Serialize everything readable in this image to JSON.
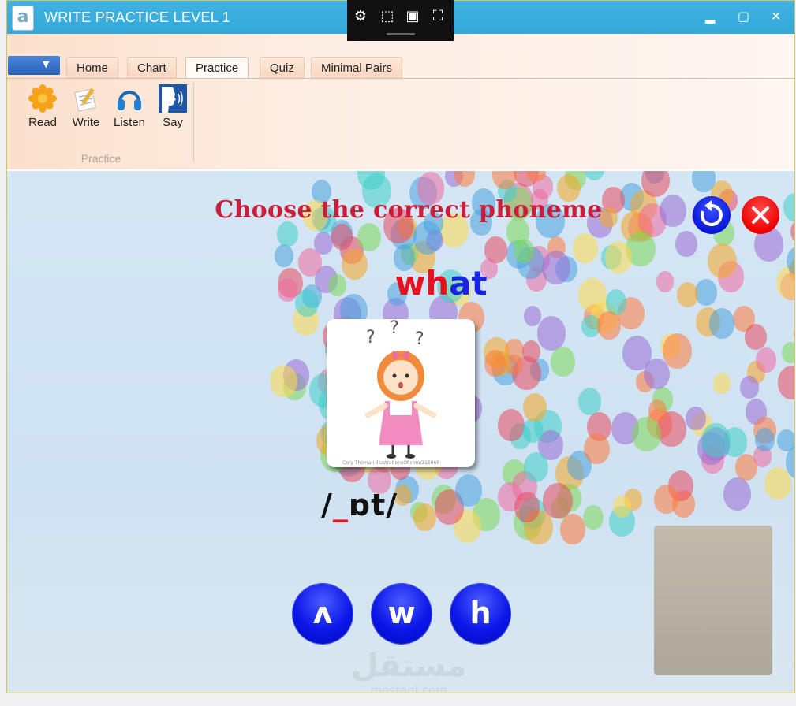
{
  "window": {
    "title": "WRITE PRACTICE LEVEL 1",
    "icon_letter": "a",
    "minimize": "▂",
    "maximize": "▢",
    "close": "✕"
  },
  "ribbon": {
    "tabs": [
      {
        "label": "Home"
      },
      {
        "label": "Chart"
      },
      {
        "label": "Practice",
        "active": true
      },
      {
        "label": "Quiz"
      },
      {
        "label": "Minimal Pairs"
      }
    ],
    "group": {
      "label": "Practice",
      "buttons": [
        {
          "label": "Read",
          "icon": "flower-icon"
        },
        {
          "label": "Write",
          "icon": "pencil-icon"
        },
        {
          "label": "Listen",
          "icon": "headphones-icon"
        },
        {
          "label": "Say",
          "icon": "speaking-head-icon"
        }
      ]
    }
  },
  "exercise": {
    "heading": "Choose the correct phoneme",
    "word_highlight": "wh",
    "word_rest": "at",
    "phoneme_open": "/",
    "phoneme_blank": "_",
    "phoneme_rest": "ɒt/",
    "answers": [
      "ʌ",
      "w",
      "h"
    ],
    "watermark_arabic": "مستقل",
    "watermark_latin": "mostaql.com",
    "picture_caption": "Cory Thoman illustrationsOf.com/215066"
  },
  "colors": {
    "title_bar": "#3fb2e2",
    "heading": "#c8203a",
    "word_highlight": "#e8101e",
    "word_rest": "#1a24e0",
    "answer_button": "#0b17e8",
    "blank": "#e8101e"
  }
}
